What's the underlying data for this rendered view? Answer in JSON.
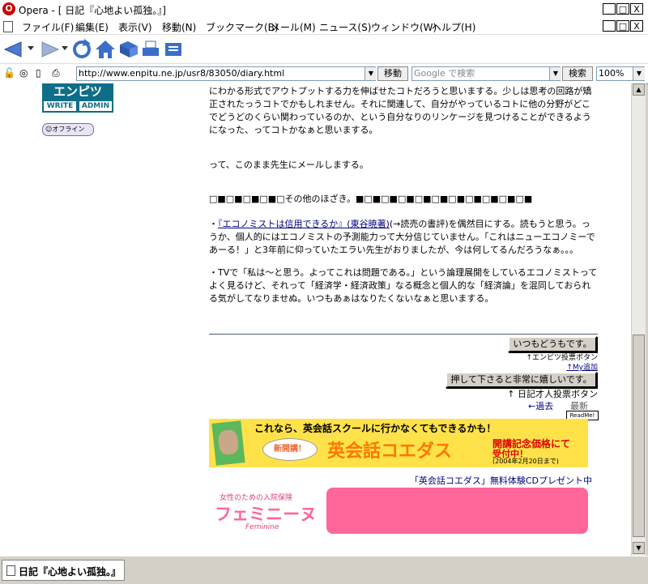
{
  "window": {
    "title": "Opera - [ 日記『心地よい孤独。』]",
    "buttons": {
      "minimize": "_",
      "maximize": "□",
      "close": "X"
    }
  },
  "menu": {
    "items": [
      "ファイル(F)",
      "編集(E)",
      "表示(V)",
      "移動(N)",
      "ブックマーク(B)",
      "メール(M)",
      "ニュース(S)",
      "ウィンドウ(W)",
      "ヘルプ(H)"
    ]
  },
  "address": {
    "url": "http://www.enpitu.ne.jp/usr8/83050/diary.html",
    "go_label": "移動",
    "search_placeholder": "Google で検索",
    "search_label": "検索",
    "zoom": "100%"
  },
  "sidebar": {
    "logo_top": "エンピツ",
    "logo_write": "WRITE",
    "logo_admin": "ADMIN",
    "offline_label": "オフライン"
  },
  "article": {
    "p1": "にわかる形式でアウトプットする力を伸ばせたコトだろうと思いまする。少しは思考の回路が矯正されたっうコトでかもしれません。それに関連して、自分がやっているコトに他の分野がどこでどうどのくらい関わっているのか、という自分なりのリンケージを見つけることができるようになった、ってコトかなぁと思いまする。",
    "p2": "って、このまま先生にメールしまする。",
    "heading": "□■□■□■□■□その他のほざき。■□■□■□■□■□■□■□■□■□■□■",
    "p3_pre": "・",
    "p3_link": "『エコノミストは信用できるか』(東谷暁著)",
    "p3_post": "(→読売の書評)を偶然目にする。読もうと思う。っうか、個人的にはエコノミストの予測能力って大分信じていません。「これはニューエコノミーであーる！」と3年前に仰っていたエラい先生がおりましたが、今は何してるんだろうなぁ。。。",
    "p4": "・TVで「私は～と思う。よってこれは問題である。」という論理展開をしているエコノミストってよく見るけど、それって「経済学・経済政策」なる概念と個人的な「経済論」を混同しておられる気がしてなりませぬ。いつもあぁはなりたくないなぁと思いまする。"
  },
  "footer": {
    "vote1_label": "いつもどうもです。",
    "vote1_note": "↑エンピツ投票ボタン",
    "my_add": "↑My追加",
    "vote2_label": "押して下さると非常に嬉しいです。",
    "vote2_note": "↑ 日記才人投票ボタン",
    "prev": "←過去",
    "latest": "最新",
    "readme": "ReadMe!"
  },
  "ad1": {
    "headline": "これなら、英会話スクールに行かなくてもできるかも！",
    "badge": "新開講！",
    "brand": "英会話コエダス",
    "price_line1": "開講記念価格にて",
    "price_line2": "受付中！",
    "price_date": "(2004年2月20日まで)",
    "caption": "「英会話コエダス」無料体験CDプレゼント中"
  },
  "ad2": {
    "tagline": "女性のための入院保険",
    "brand": "フェミニーヌ",
    "brand_en": "Feminine"
  },
  "statusbar": {
    "tab_label": "日記『心地よい孤独。』"
  },
  "colors": {
    "accent_pink": "#ff6699",
    "ad_yellow": "#ffe24a",
    "ad_orange": "#ff7700",
    "logo_teal": "#0e6e87"
  }
}
